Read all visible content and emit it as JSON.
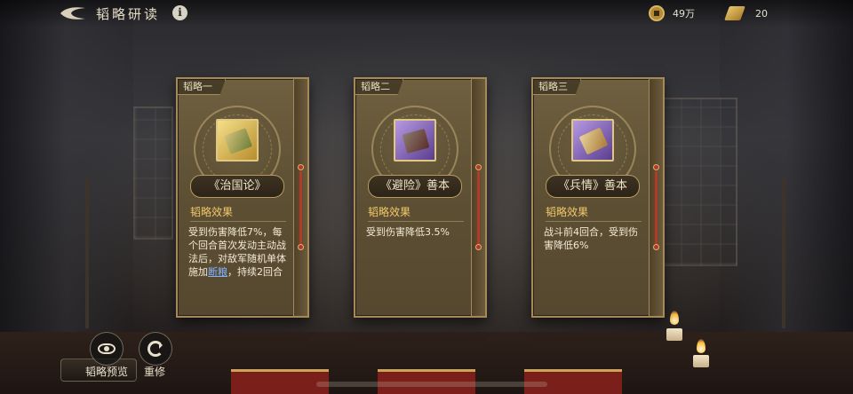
{
  "header": {
    "title": "韬略研读",
    "info_glyph": "i"
  },
  "resources": {
    "coins": "49万",
    "scrolls": "20"
  },
  "cards": [
    {
      "tab": "韬略一",
      "name": "《治国论》",
      "section_title": "韬略效果",
      "effect_pre": "受到伤害降低7%，每个回合首次发动主动战法后，对敌军随机单体施加",
      "effect_highlight": "断粮",
      "effect_post": "，持续2回合",
      "icon": "scroll-bundle-icon",
      "rarity_color": "#e0c060"
    },
    {
      "tab": "韬略二",
      "name": "《避险》善本",
      "section_title": "韬略效果",
      "effect": "受到伤害降低3.5%",
      "icon": "book-stack-icon",
      "rarity_color": "#8a6cc8"
    },
    {
      "tab": "韬略三",
      "name": "《兵情》善本",
      "section_title": "韬略效果",
      "effect": "战斗前4回合，受到伤害降低6%",
      "icon": "map-scroll-icon",
      "rarity_color": "#8a6cc8"
    }
  ],
  "actions": {
    "preview_label": "韬略预览",
    "retrain_label": "重修"
  }
}
